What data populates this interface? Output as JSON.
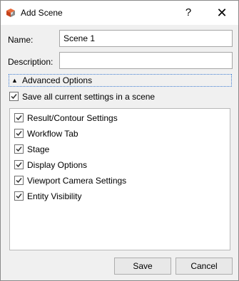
{
  "window": {
    "title": "Add Scene",
    "help_label": "?",
    "close_label": "✕"
  },
  "form": {
    "name_label": "Name:",
    "name_value": "Scene 1",
    "description_label": "Description:",
    "description_value": ""
  },
  "advanced": {
    "label": "Advanced Options",
    "expanded": true,
    "save_all_label": "Save all current settings in a scene",
    "save_all_checked": true
  },
  "settings_list": [
    {
      "label": "Result/Contour Settings",
      "checked": true
    },
    {
      "label": "Workflow Tab",
      "checked": true
    },
    {
      "label": "Stage",
      "checked": true
    },
    {
      "label": "Display Options",
      "checked": true
    },
    {
      "label": "Viewport Camera Settings",
      "checked": true
    },
    {
      "label": "Entity Visibility",
      "checked": true
    }
  ],
  "buttons": {
    "save": "Save",
    "cancel": "Cancel"
  }
}
